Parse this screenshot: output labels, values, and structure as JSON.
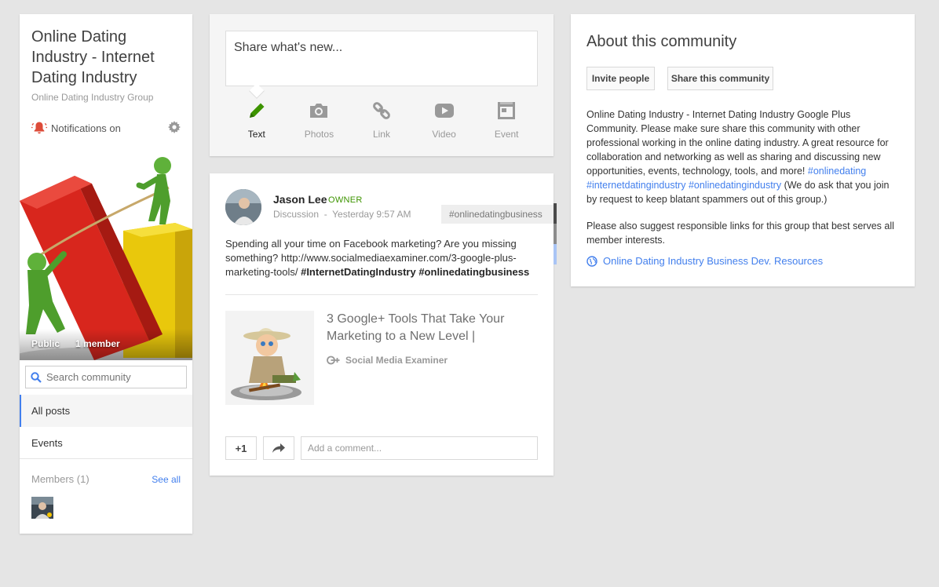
{
  "community": {
    "title": "Online Dating Industry - Internet Dating Industry",
    "subtitle": "Online Dating Industry Group",
    "notifications_label": "Notifications on",
    "visibility": "Public",
    "member_count": "1 member",
    "search_placeholder": "Search community",
    "nav": {
      "all_posts": "All posts",
      "events": "Events"
    },
    "members_label": "Members (1)",
    "see_all": "See all"
  },
  "share_box": {
    "placeholder": "Share what's new...",
    "tools": [
      {
        "label": "Text",
        "icon": "pencil-icon",
        "active": true
      },
      {
        "label": "Photos",
        "icon": "camera-icon",
        "active": false
      },
      {
        "label": "Link",
        "icon": "link-icon",
        "active": false
      },
      {
        "label": "Video",
        "icon": "play-icon",
        "active": false
      },
      {
        "label": "Event",
        "icon": "calendar-icon",
        "active": false
      }
    ]
  },
  "post": {
    "author": "Jason Lee",
    "role": "OWNER",
    "category": "Discussion",
    "separator": "-",
    "time": "Yesterday 9:57 AM",
    "tag": "#onlinedatingbusiness",
    "text_plain": "Spending all your time on Facebook marketing? Are you missing something? http://www.socialmediaexaminer.com/3-google-plus-marketing-tools/ ",
    "text_hashtags": "#InternetDatingIndustry #onlinedatingbusiness",
    "link_title": "3 Google+ Tools That Take Your Marketing to a New Level |",
    "link_source": "Social Media Examiner",
    "plus_one": "+1",
    "comment_placeholder": "Add a comment..."
  },
  "about": {
    "title": "About this community",
    "invite_btn": "Invite people",
    "share_btn": "Share this community",
    "description": "Online Dating Industry - Internet Dating Industry Google Plus Community. Please make sure share this community with other professional working in the online dating industry. A great resource for collaboration and networking as well as sharing and discussing new opportunities, events, technology, tools, and more! ",
    "hashtags": "#onlinedating #internetdatingindustry #onlinedatingindustry",
    "description_tail": " (We do ask that you join by request to keep blatant spammers out of this group.)",
    "description2": "Please also suggest responsible links for this group that best serves all member interests.",
    "link_label": "Online Dating Industry Business Dev. Resources"
  },
  "colors": {
    "accent_blue": "#427fed",
    "notification_red": "#dd4b39",
    "owner_green": "#3d9400",
    "active_tool_green": "#3d9400"
  }
}
